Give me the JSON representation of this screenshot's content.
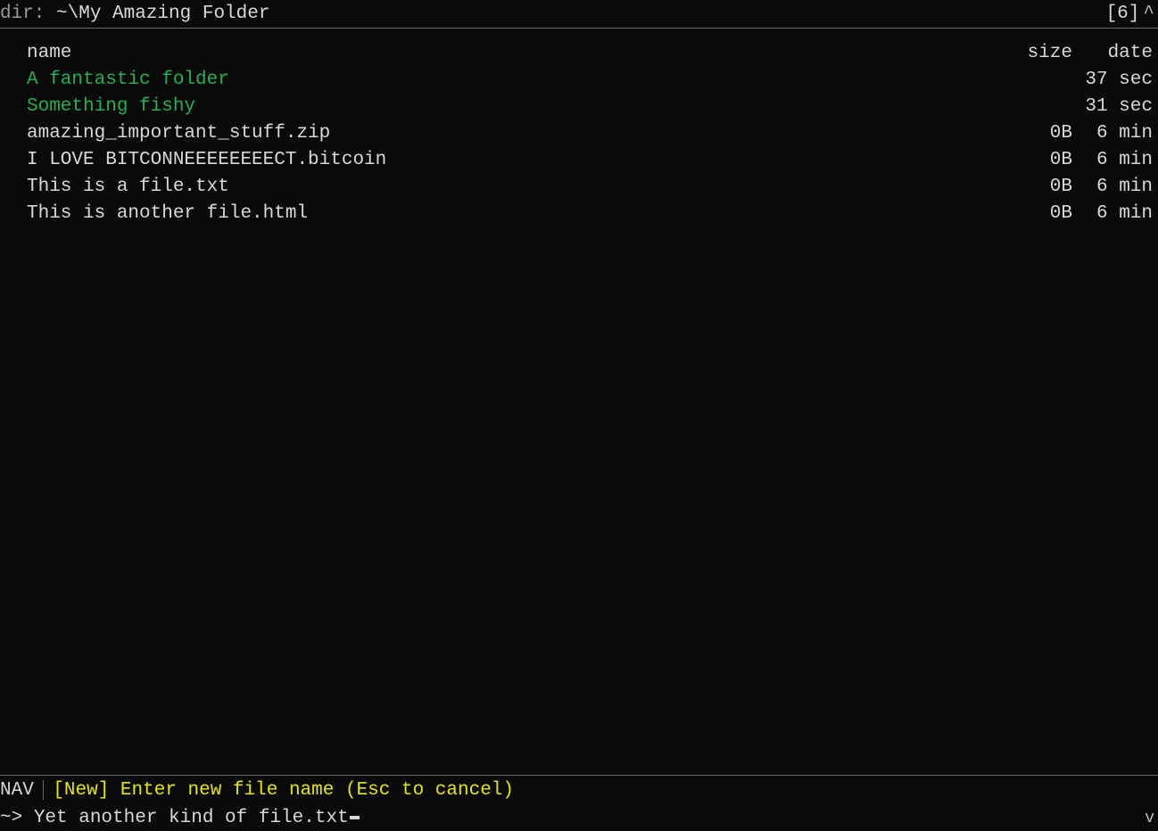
{
  "header": {
    "dir_label": "dir: ",
    "path": "~\\My Amazing Folder",
    "count": "[6]",
    "scroll_up_glyph": "^"
  },
  "columns": {
    "name": "name",
    "size": "size",
    "date": "date"
  },
  "items": [
    {
      "name": "A fantastic folder",
      "size": "",
      "date": "37 sec",
      "type": "folder"
    },
    {
      "name": "Something fishy",
      "size": "",
      "date": "31 sec",
      "type": "folder"
    },
    {
      "name": "amazing_important_stuff.zip",
      "size": "0B",
      "date": "6 min",
      "type": "file"
    },
    {
      "name": "I LOVE BITCONNEEEEEEEECT.bitcoin",
      "size": "0B",
      "date": "6 min",
      "type": "file"
    },
    {
      "name": "This is a file.txt",
      "size": "0B",
      "date": "6 min",
      "type": "file"
    },
    {
      "name": "This is another file.html",
      "size": "0B",
      "date": "6 min",
      "type": "file"
    }
  ],
  "status": {
    "mode": "NAV",
    "hint": "[New] Enter new file name (Esc to cancel)"
  },
  "input": {
    "prompt": "~> ",
    "value": "Yet another kind of file.txt"
  },
  "scroll_down_glyph": "v"
}
